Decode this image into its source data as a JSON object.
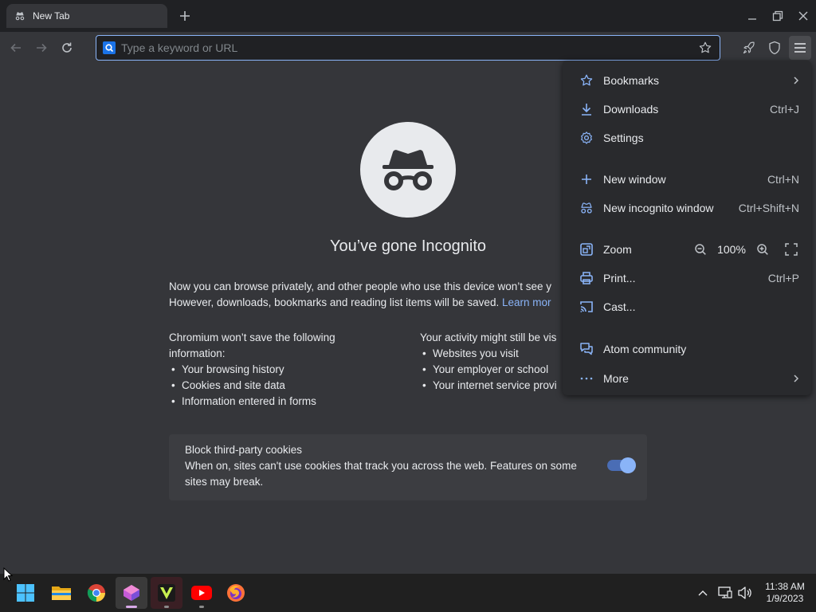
{
  "browser": {
    "tab_title": "New Tab",
    "omnibox_placeholder": "Type a keyword or URL"
  },
  "page": {
    "headline": "You’ve gone Incognito",
    "intro_line1": "Now you can browse privately, and other people who use this device won’t see y",
    "intro_line2": "However, downloads, bookmarks and reading list items will be saved.",
    "learn_more": "Learn mor",
    "left_heading_line1": "Chromium won’t save the following",
    "left_heading_line2": "information:",
    "left_items": [
      "Your browsing history",
      "Cookies and site data",
      "Information entered in forms"
    ],
    "right_heading": "Your activity might still be vis",
    "right_items": [
      "Websites you visit",
      "Your employer or school",
      "Your internet service provi"
    ],
    "cookies_title": "Block third-party cookies",
    "cookies_desc": "When on, sites can't use cookies that track you across the web. Features on some sites may break.",
    "cookies_toggle_on": true
  },
  "menu": {
    "items": [
      {
        "label": "Bookmarks",
        "shortcut": "",
        "icon": "star-icon",
        "submenu": true
      },
      {
        "label": "Downloads",
        "shortcut": "Ctrl+J",
        "icon": "download-icon"
      },
      {
        "label": "Settings",
        "shortcut": "",
        "icon": "gear-icon"
      },
      {
        "label": "New window",
        "shortcut": "Ctrl+N",
        "icon": "plus-icon"
      },
      {
        "label": "New incognito window",
        "shortcut": "Ctrl+Shift+N",
        "icon": "incognito-icon"
      },
      {
        "label": "Zoom",
        "shortcut": "",
        "icon": "zoom-icon"
      },
      {
        "label": "Print...",
        "shortcut": "Ctrl+P",
        "icon": "printer-icon"
      },
      {
        "label": "Cast...",
        "shortcut": "",
        "icon": "cast-icon"
      },
      {
        "label": "Atom community",
        "shortcut": "",
        "icon": "chat-icon"
      },
      {
        "label": "More",
        "shortcut": "",
        "icon": "more-dots-icon",
        "submenu": true
      }
    ],
    "zoom_level": "100%"
  },
  "taskbar": {
    "apps": [
      "windows-start",
      "file-explorer",
      "chrome",
      "atom-browser",
      "vivaldi",
      "youtube",
      "firefox"
    ],
    "time": "11:38 AM",
    "date": "1/9/2023"
  },
  "colors": {
    "accent": "#8ab4f8",
    "page_bg": "#35363a",
    "menu_bg": "#292a2d",
    "taskbar_bg": "#202020"
  }
}
